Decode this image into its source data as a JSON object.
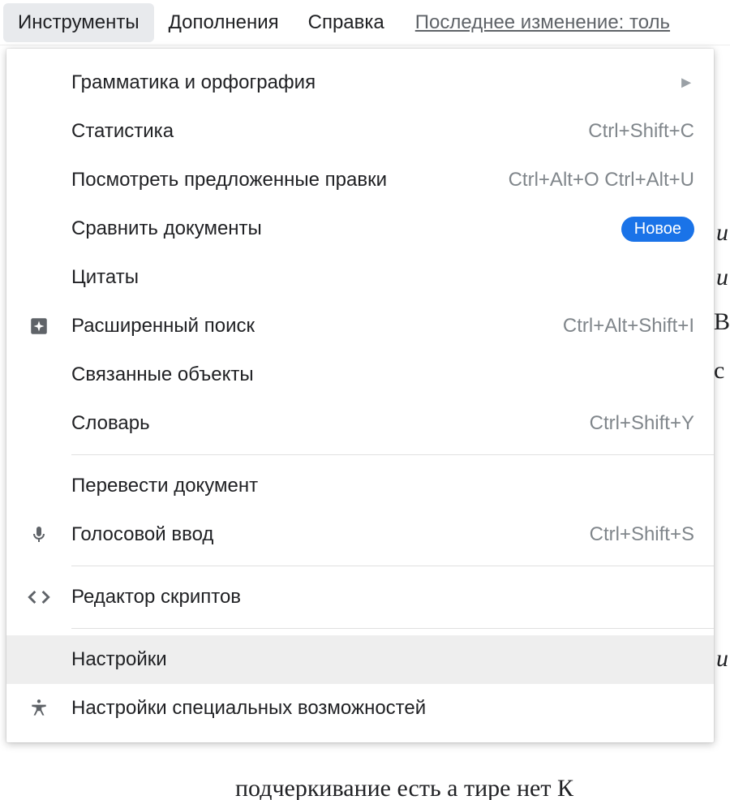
{
  "menubar": {
    "tools": "Инструменты",
    "addons": "Дополнения",
    "help": "Справка",
    "last_edit": "Последнее изменение: толь"
  },
  "menu": {
    "grammar": "Грамматика и орфография",
    "stats": {
      "label": "Статистика",
      "shortcut": "Ctrl+Shift+C"
    },
    "review": {
      "label": "Посмотреть предложенные правки",
      "shortcut": "Ctrl+Alt+O Ctrl+Alt+U"
    },
    "compare": {
      "label": "Сравнить документы",
      "badge": "Новое"
    },
    "citations": "Цитаты",
    "explore": {
      "label": "Расширенный поиск",
      "shortcut": "Ctrl+Alt+Shift+I"
    },
    "linked": "Связанные объекты",
    "dictionary": {
      "label": "Словарь",
      "shortcut": "Ctrl+Shift+Y"
    },
    "translate": "Перевести документ",
    "voice": {
      "label": "Голосовой ввод",
      "shortcut": "Ctrl+Shift+S"
    },
    "script": "Редактор скриптов",
    "prefs": "Настройки",
    "a11y": "Настройки специальных возможностей"
  },
  "bg": {
    "t1": "В",
    "t2": "с",
    "t3": "и",
    "t4": "и",
    "bottom": "подчеркивание есть  а тире нет  К"
  }
}
